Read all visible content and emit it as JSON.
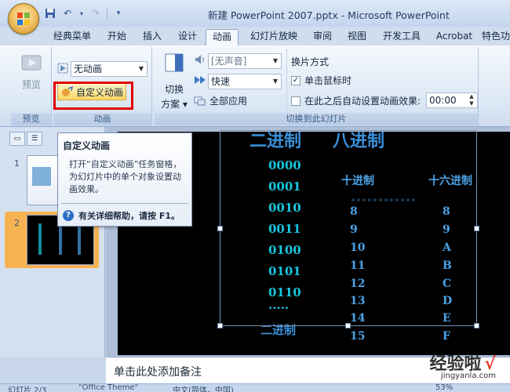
{
  "window": {
    "title": "新建 PowerPoint 2007.pptx - Microsoft PowerPoint"
  },
  "qat": {
    "icons": [
      "save-icon",
      "undo-icon",
      "redo-icon",
      "customize-icon"
    ]
  },
  "tabs": [
    {
      "label": "经典菜单"
    },
    {
      "label": "开始"
    },
    {
      "label": "插入"
    },
    {
      "label": "设计"
    },
    {
      "label": "动画",
      "active": true
    },
    {
      "label": "幻灯片放映"
    },
    {
      "label": "审阅"
    },
    {
      "label": "视图"
    },
    {
      "label": "开发工具"
    },
    {
      "label": "Acrobat"
    },
    {
      "label": "特色功"
    }
  ],
  "ribbon": {
    "preview": {
      "button_label": "预览",
      "group_label": "预览"
    },
    "animation": {
      "combo_value": "无动画",
      "custom_label": "自定义动画",
      "group_label": "动画"
    },
    "transition": {
      "scheme_label_1": "切换",
      "scheme_label_2": "方案",
      "sound_value": "[无声音]",
      "speed_value": "快速",
      "apply_all_label": "全部应用",
      "advance_title": "换片方式",
      "on_click_label": "单击鼠标时",
      "on_click_checked": true,
      "auto_after_label": "在此之后自动设置动画效果:",
      "auto_after_checked": false,
      "auto_time": "00:00",
      "group_label": "切换到此幻灯片"
    }
  },
  "slides_pane": {
    "slide_numbers": [
      "1",
      "2"
    ],
    "active_slide": 2
  },
  "tooltip": {
    "title": "自定义动画",
    "body": "打开“自定义动画”任务窗格，为幻灯片中的单个对象设置动画效果。",
    "help": "有关详细帮助，请按 F1。"
  },
  "slide": {
    "heading_left": "二进制",
    "heading_right": "八进制",
    "binary_values": [
      "0000",
      "0001",
      "0010",
      "0011",
      "0100",
      "0101",
      "0110",
      "·····"
    ],
    "binary_footer": "二进制",
    "decimal_header": "十进制",
    "hex_header": "十六进制",
    "dots": "。。。。。。。。。。。。",
    "decimal_values": [
      "8",
      "9",
      "10",
      "11",
      "12",
      "13",
      "14",
      "15"
    ],
    "hex_values": [
      "8",
      "9",
      "A",
      "B",
      "C",
      "D",
      "E",
      "F"
    ]
  },
  "notes": {
    "placeholder": "单击此处添加备注"
  },
  "status": {
    "left": "幻灯片 2/3",
    "theme": "\"Office Theme\"",
    "language": "中文(简体，中国)",
    "zoom": "53%"
  },
  "watermark": {
    "text": "经验啦",
    "check": "√",
    "url": "jingyanla.com"
  }
}
